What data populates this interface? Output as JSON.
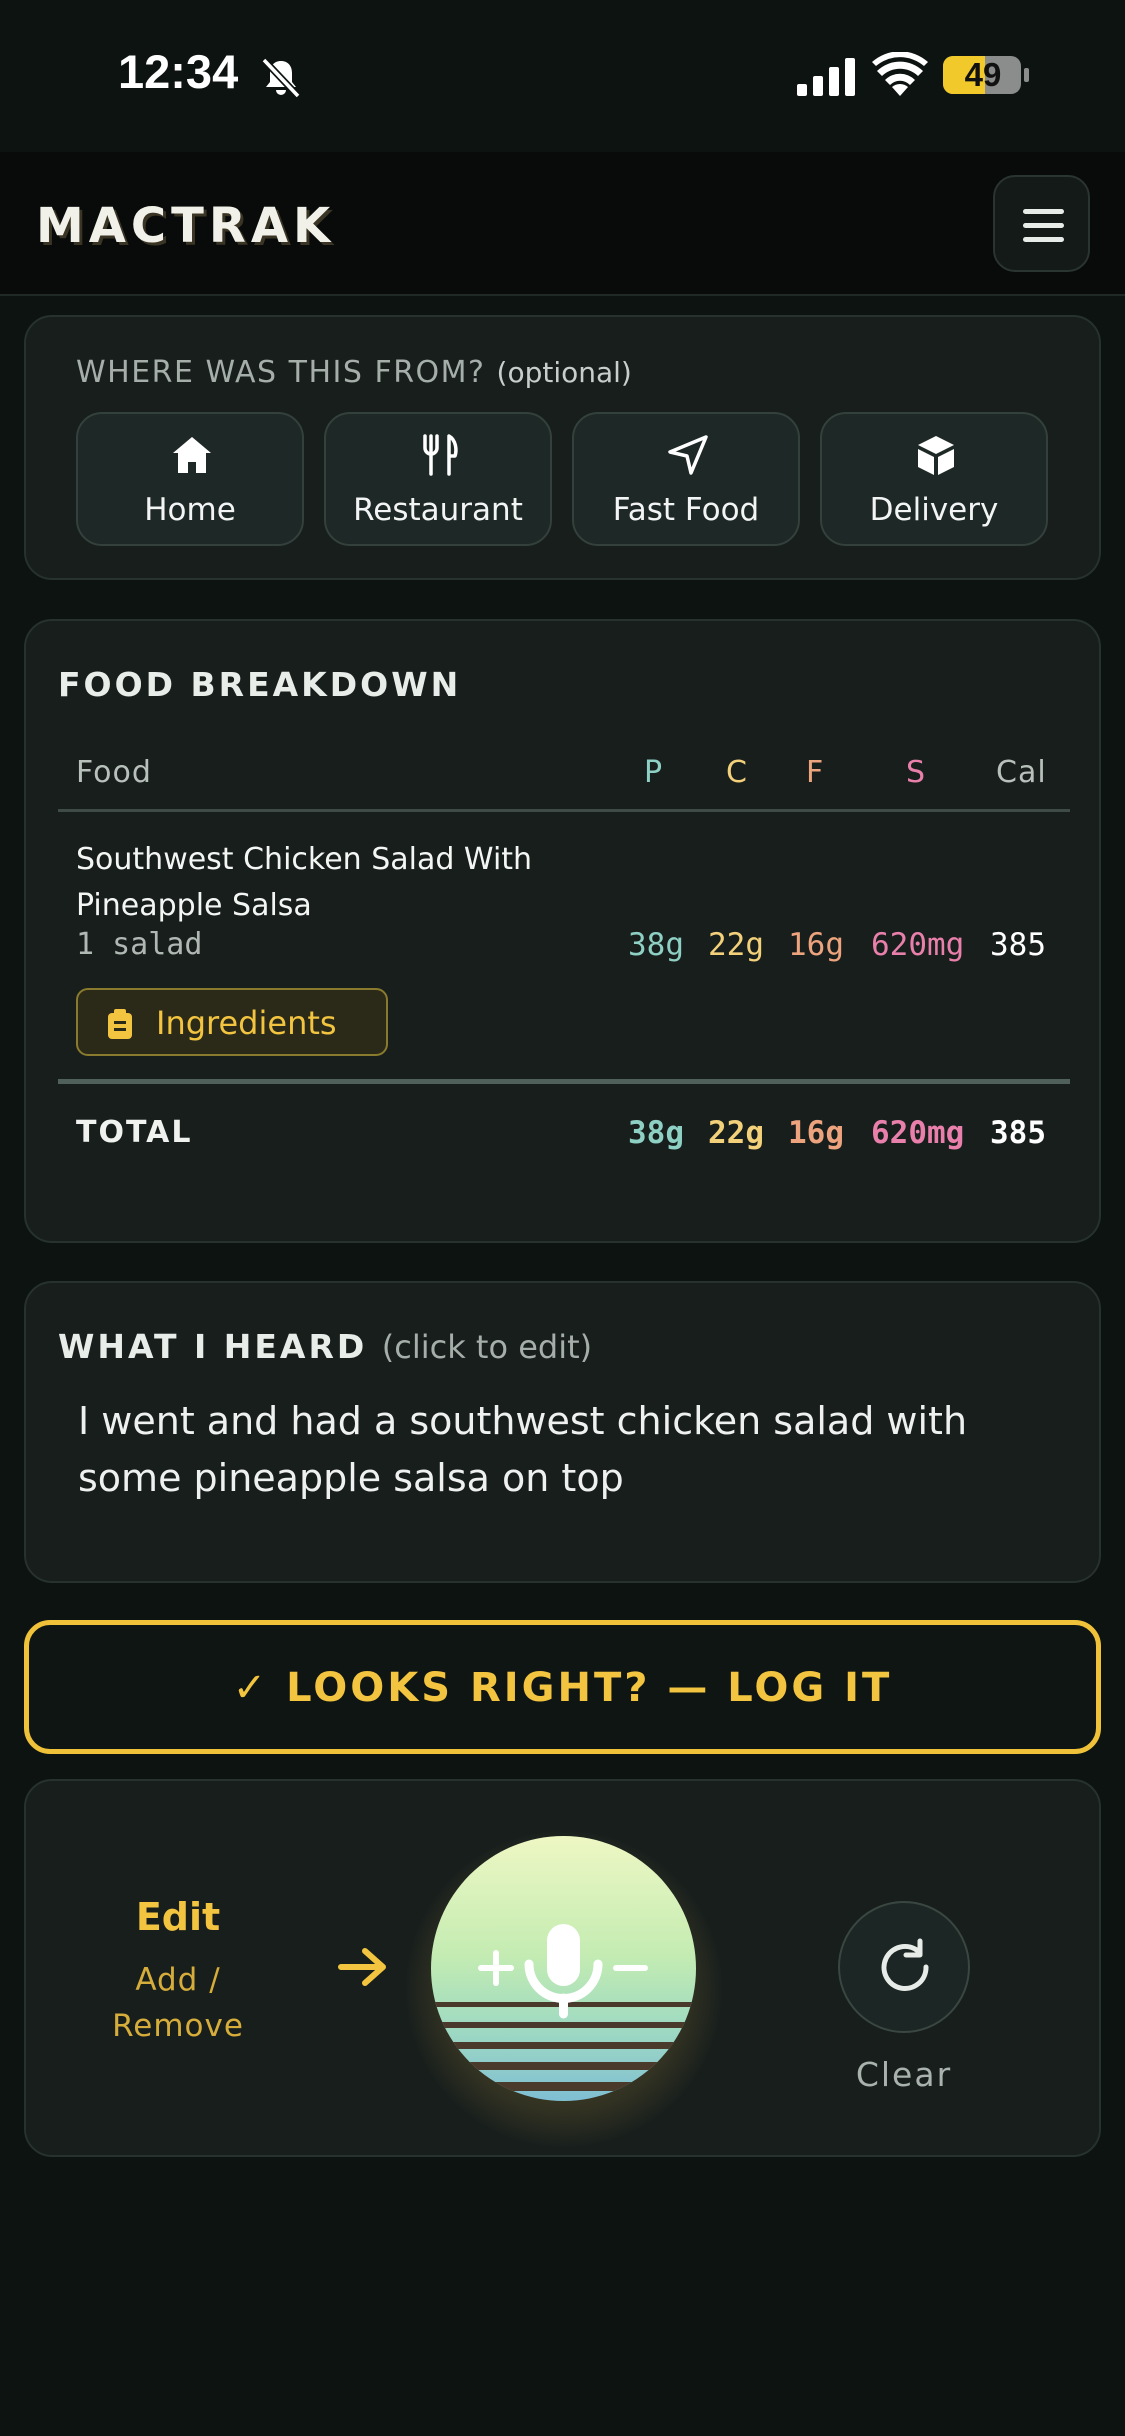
{
  "status_bar": {
    "time": "12:34",
    "battery": "49"
  },
  "header": {
    "title": "MACTRAK"
  },
  "source": {
    "label": "WHERE WAS THIS FROM?",
    "optional": "(optional)",
    "options": [
      {
        "label": "Home",
        "icon": "home-icon"
      },
      {
        "label": "Restaurant",
        "icon": "utensils-icon"
      },
      {
        "label": "Fast Food",
        "icon": "navigation-arrow-icon"
      },
      {
        "label": "Delivery",
        "icon": "box-icon"
      }
    ]
  },
  "breakdown": {
    "title": "FOOD BREAKDOWN",
    "columns": {
      "food": "Food",
      "p": "P",
      "c": "C",
      "f": "F",
      "s": "S",
      "cal": "Cal"
    },
    "items": [
      {
        "name": "Southwest Chicken Salad With Pineapple Salsa",
        "quantity": "1 salad",
        "protein": "38g",
        "carbs": "22g",
        "fat": "16g",
        "sodium": "620mg",
        "calories": "385",
        "ingredients_label": "Ingredients"
      }
    ],
    "total": {
      "label": "TOTAL",
      "protein": "38g",
      "carbs": "22g",
      "fat": "16g",
      "sodium": "620mg",
      "calories": "385"
    }
  },
  "heard": {
    "title": "WHAT I HEARD",
    "hint": "(click to edit)",
    "text": "I went and had a southwest chicken salad with some pineapple salsa on top"
  },
  "log_button": {
    "label": "✓ LOOKS RIGHT? — LOG IT"
  },
  "voice": {
    "edit_label": "Edit",
    "edit_sub_1": "Add /",
    "edit_sub_2": "Remove",
    "clear_label": "Clear"
  },
  "colors": {
    "protein": "#8fd0c4",
    "carbs": "#f3d07a",
    "fat": "#eca37e",
    "sodium": "#e97fab",
    "accent": "#f2c43f",
    "background": "#0d1311"
  }
}
